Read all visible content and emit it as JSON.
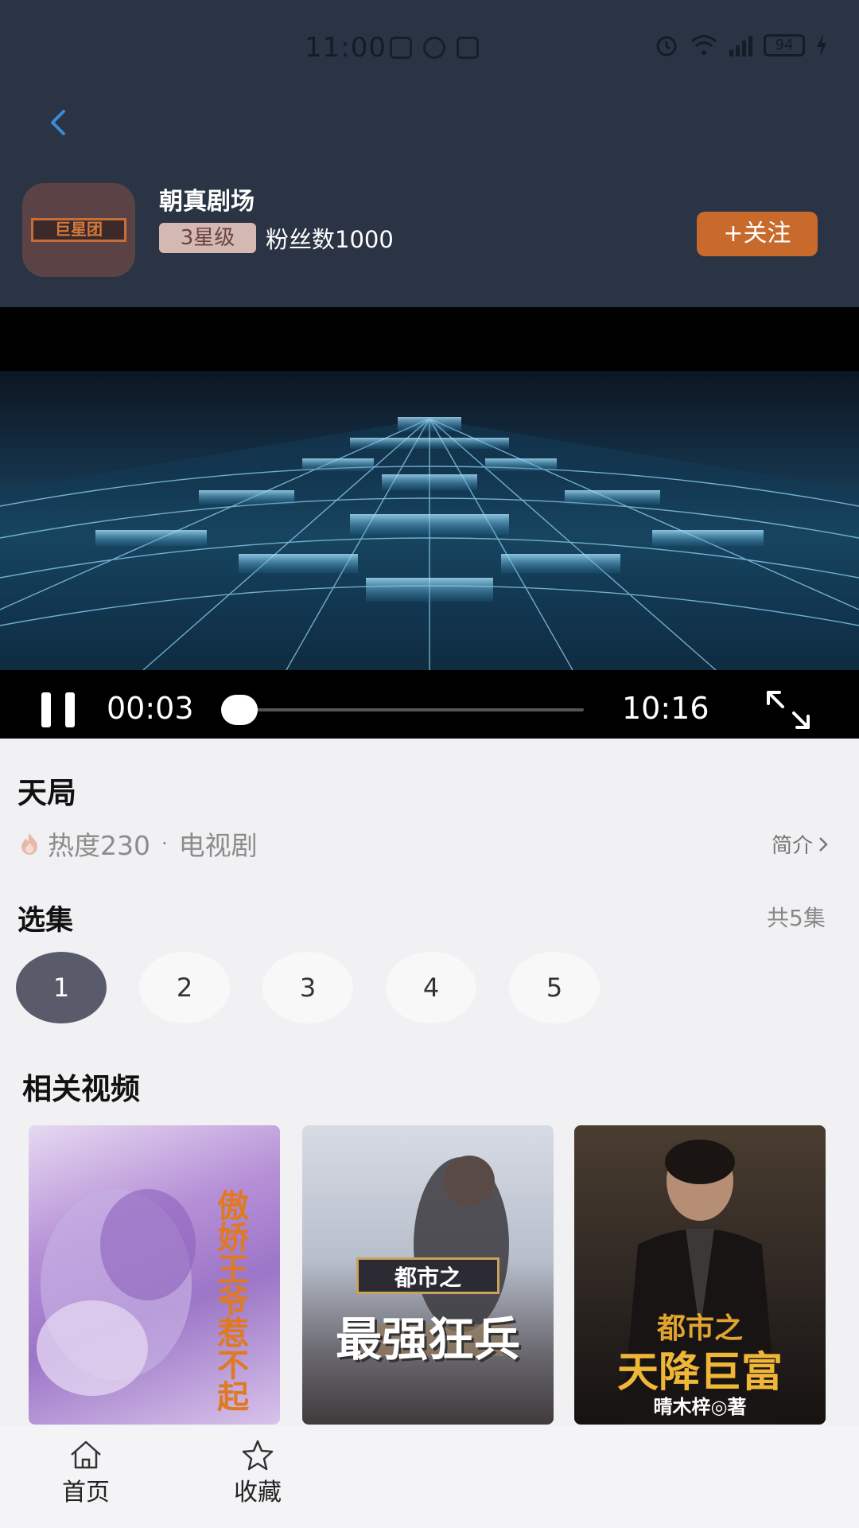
{
  "status_bar": {
    "time": "11:00",
    "battery": "94"
  },
  "channel": {
    "name": "朝真剧场",
    "level": "3星级",
    "fans": "粉丝数1000",
    "follow_label": "+关注",
    "logo_text": "巨星团"
  },
  "player": {
    "current_time": "00:03",
    "total_time": "10:16",
    "progress": 0.005
  },
  "show": {
    "title": "天局",
    "heat": "热度230",
    "separator": "·",
    "category": "电视剧",
    "intro_label": "简介"
  },
  "episodes": {
    "title": "选集",
    "total": "共5集",
    "items": [
      "1",
      "2",
      "3",
      "4",
      "5"
    ],
    "selected": "1"
  },
  "related": {
    "title": "相关视频",
    "posters": [
      {
        "text": "傲娇王爷惹不起"
      },
      {
        "top": "都市之",
        "main": "最强狂兵"
      },
      {
        "top": "都市之",
        "main": "天降巨富",
        "author": "晴木梓◎著"
      }
    ]
  },
  "bottom_nav": {
    "home_label": "首页",
    "favorites_label": "收藏"
  }
}
